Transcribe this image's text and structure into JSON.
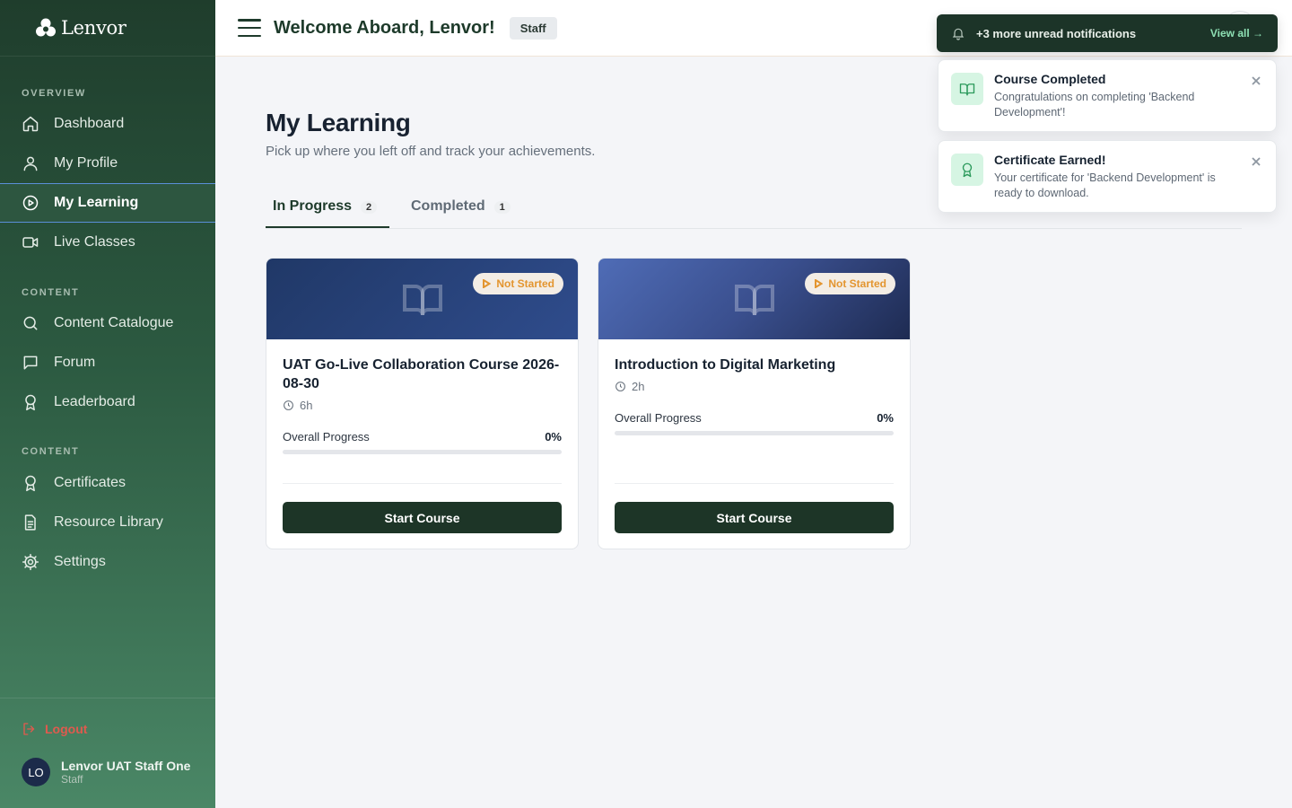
{
  "brand": {
    "name": "Lenvor"
  },
  "sidebar": {
    "sections": [
      {
        "label": "OVERVIEW"
      },
      {
        "label": "CONTENT"
      },
      {
        "label": "CONTENT"
      }
    ],
    "items": [
      {
        "label": "Dashboard",
        "icon": "home-icon"
      },
      {
        "label": "My Profile",
        "icon": "user-icon"
      },
      {
        "label": "My Learning",
        "icon": "play-circle-icon",
        "active": true
      },
      {
        "label": "Live Classes",
        "icon": "video-icon"
      },
      {
        "label": "Content Catalogue",
        "icon": "search-icon"
      },
      {
        "label": "Forum",
        "icon": "chat-icon"
      },
      {
        "label": "Leaderboard",
        "icon": "award-icon"
      },
      {
        "label": "Certificates",
        "icon": "award-icon"
      },
      {
        "label": "Resource Library",
        "icon": "document-icon"
      },
      {
        "label": "Settings",
        "icon": "gear-icon"
      }
    ],
    "logout_label": "Logout",
    "user": {
      "initials": "LO",
      "name": "Lenvor UAT Staff One",
      "role": "Staff"
    }
  },
  "header": {
    "welcome": "Welcome Aboard, Lenvor!",
    "role_badge": "Staff"
  },
  "page": {
    "title": "My Learning",
    "subtitle": "Pick up where you left off and track your achievements."
  },
  "tabs": [
    {
      "label": "In Progress",
      "count": "2",
      "active": true
    },
    {
      "label": "Completed",
      "count": "1",
      "active": false
    }
  ],
  "courses": [
    {
      "status": "Not Started",
      "title": "UAT Go-Live Collaboration Course 2026-08-30",
      "duration": "6h",
      "progress_label": "Overall Progress",
      "progress_text": "0%",
      "progress_value": 0,
      "button": "Start Course"
    },
    {
      "status": "Not Started",
      "title": "Introduction to Digital Marketing",
      "duration": "2h",
      "progress_label": "Overall Progress",
      "progress_text": "0%",
      "progress_value": 0,
      "button": "Start Course"
    }
  ],
  "notifications": {
    "summary": "+3 more unread notifications",
    "view_all": "View all →",
    "toasts": [
      {
        "title": "Course Completed",
        "message": "Congratulations on completing 'Backend Development'!",
        "icon": "book-icon"
      },
      {
        "title": "Certificate Earned!",
        "message": "Your certificate for 'Backend Development' is ready to download.",
        "icon": "award-icon"
      }
    ]
  },
  "colors": {
    "sidebar_dark": "#1f3d2c",
    "primary": "#1d3527",
    "status_orange": "#e3952f",
    "accent_green": "#2c9a5c"
  }
}
